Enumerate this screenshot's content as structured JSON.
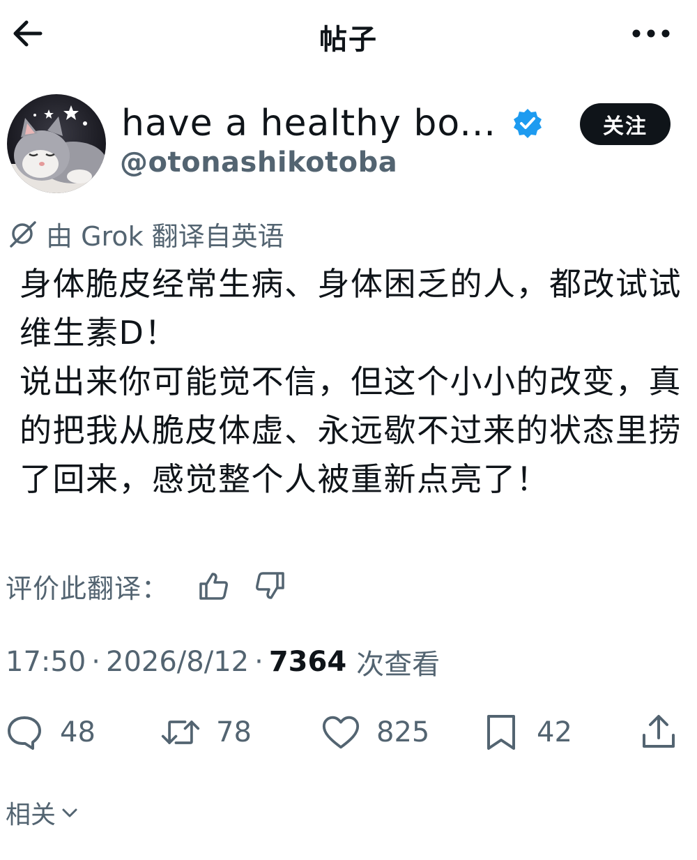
{
  "header": {
    "title": "帖子"
  },
  "author": {
    "display_name": "have a healthy bo...",
    "handle": "@otonashikotoba",
    "follow_label": "关注",
    "verified": true,
    "badge_color": "#1d9bf0"
  },
  "translation": {
    "note": "由 Grok 翻译自英语",
    "rate_label": "评价此翻译："
  },
  "post": {
    "text": "身体脆皮经常生病、身体困乏的人，都改试试维生素D！\n说出来你可能觉不信，但这个小小的改变，真的把我从脆皮体虚、永远歇不过来的状态里捞了回来，感觉整个人被重新点亮了！"
  },
  "meta": {
    "time": "17:50",
    "date": "2026/8/12",
    "views": "7364",
    "views_label": "次查看"
  },
  "actions": {
    "replies": "48",
    "reposts": "78",
    "likes": "825",
    "bookmarks": "42"
  },
  "related": {
    "label": "相关"
  },
  "colors": {
    "text_primary": "#0f1419",
    "text_secondary": "#536471",
    "follow_bg": "#0f1419"
  }
}
